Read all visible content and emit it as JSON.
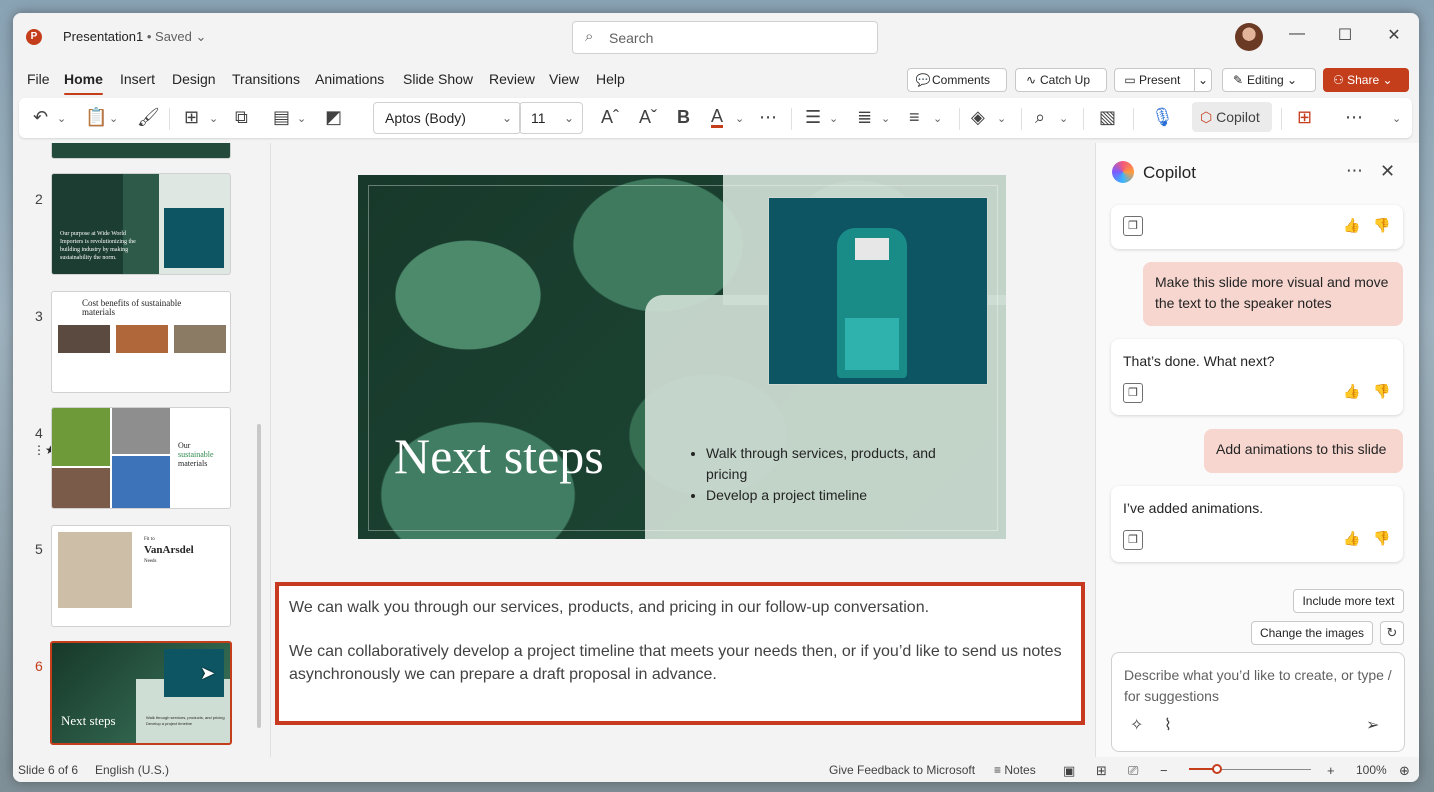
{
  "window": {
    "doc_title": "Presentation1",
    "saved_status": "• Saved",
    "search_placeholder": "Search"
  },
  "menu": {
    "items": [
      "File",
      "Home",
      "Insert",
      "Design",
      "Transitions",
      "Animations",
      "Slide Show",
      "Review",
      "View",
      "Help"
    ],
    "active": "Home",
    "comments": "Comments",
    "catch_up": "Catch Up",
    "present": "Present",
    "editing": "Editing",
    "share": "Share"
  },
  "ribbon": {
    "font_name": "Aptos (Body)",
    "font_size": "11",
    "copilot_label": "Copilot"
  },
  "thumbnails": {
    "numbers": [
      "2",
      "3",
      "4",
      "5",
      "6"
    ],
    "slide2_text": "Our purpose at Wide World Importers is revolutionizing the building industry by making sustainability the norm.",
    "slide3_title": "Cost benefits of sustainable materials",
    "slide4_title_a": "Our",
    "slide4_title_b": "sustainable",
    "slide4_title_c": "materials",
    "slide5_title_a": "Fit to",
    "slide5_title_b": "VanArsdel",
    "slide5_title_c": "Needs",
    "slide6_title": "Next steps",
    "slide6_b1": "Walk through services, products, and pricing",
    "slide6_b2": "Develop a project timeline"
  },
  "slide": {
    "title": "Next steps",
    "bullets": [
      "Walk through services, products, and pricing",
      "Develop a project timeline"
    ]
  },
  "notes": {
    "p1": "We can walk you through our services, products, and pricing in our follow-up conversation.",
    "p2": "We can collaboratively develop a project timeline that meets your needs then, or if you’d like to send us notes asynchronously we can prepare a draft proposal in advance."
  },
  "copilot": {
    "title": "Copilot",
    "messages": [
      {
        "role": "user",
        "text": "Make this slide more visual and move the text to the speaker notes"
      },
      {
        "role": "assistant",
        "text": "That’s done. What next?"
      },
      {
        "role": "user",
        "text": "Add animations to this slide"
      },
      {
        "role": "assistant",
        "text": "I’ve added animations."
      }
    ],
    "suggestions": [
      "Include more text",
      "Change the images"
    ],
    "composer_placeholder": "Describe what you’d like to create, or type / for suggestions"
  },
  "status": {
    "slide_count": "Slide 6 of 6",
    "language": "English (U.S.)",
    "feedback": "Give Feedback to Microsoft",
    "notes": "Notes",
    "zoom": "100%",
    "zoom_level": 0.23
  },
  "colors": {
    "accent": "#c43e1c",
    "notes_highlight": "#c73a1f",
    "user_bubble": "#f6d6cf"
  }
}
